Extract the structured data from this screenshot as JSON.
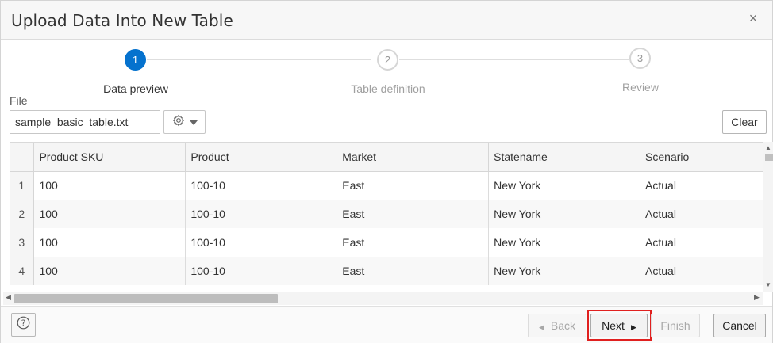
{
  "dialog": {
    "title": "Upload Data Into New Table",
    "close_glyph": "×"
  },
  "steps": [
    {
      "number": "1",
      "label": "Data preview",
      "state": "active"
    },
    {
      "number": "2",
      "label": "Table definition",
      "state": "inactive"
    },
    {
      "number": "3",
      "label": "Review",
      "state": "inactive"
    }
  ],
  "file": {
    "label": "File",
    "value": "sample_basic_table.txt"
  },
  "toolbar": {
    "settings_icon": "gear-icon",
    "clear_label": "Clear"
  },
  "table": {
    "columns": [
      "Product SKU",
      "Product",
      "Market",
      "Statename",
      "Scenario"
    ],
    "rows": [
      {
        "num": "1",
        "cells": [
          "100",
          "100-10",
          "East",
          "New York",
          "Actual"
        ]
      },
      {
        "num": "2",
        "cells": [
          "100",
          "100-10",
          "East",
          "New York",
          "Actual"
        ]
      },
      {
        "num": "3",
        "cells": [
          "100",
          "100-10",
          "East",
          "New York",
          "Actual"
        ]
      },
      {
        "num": "4",
        "cells": [
          "100",
          "100-10",
          "East",
          "New York",
          "Actual"
        ]
      }
    ]
  },
  "footer": {
    "help_icon": "help-icon",
    "back_label": "Back",
    "next_label": "Next",
    "finish_label": "Finish",
    "cancel_label": "Cancel"
  },
  "colors": {
    "accent": "#0572ce",
    "highlight": "#e0201f"
  }
}
